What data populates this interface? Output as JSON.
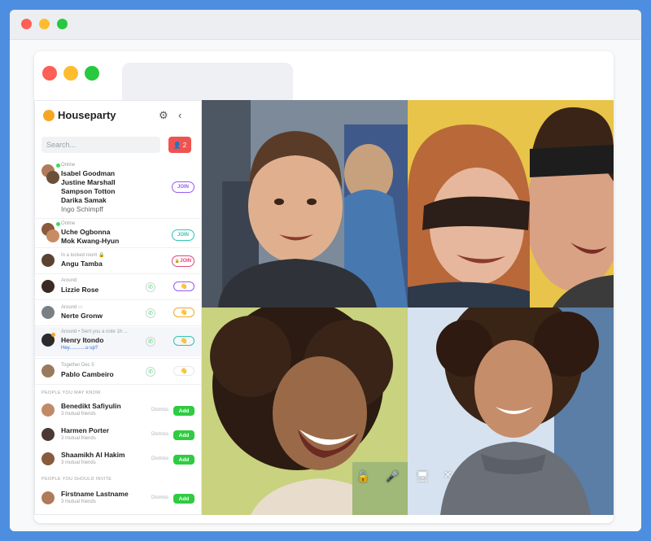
{
  "app": {
    "name": "Houseparty",
    "search_placeholder": "Search...",
    "friend_requests_count": "2",
    "settings_icon": "gear-icon",
    "collapse_icon": "chevron-left-icon"
  },
  "contacts": [
    {
      "status": "Online",
      "names": [
        "Isabel Goodman",
        "Justine Marshall",
        "Sampson Totton",
        "Darika Samak",
        "Ingo Schimpff"
      ],
      "action": "JOIN"
    },
    {
      "status": "Online",
      "names": [
        "Uche Ogbonna",
        "Mok Kwang-Hyun"
      ],
      "action": "JOIN"
    },
    {
      "status": "In a locked room",
      "names": [
        "Angu Tamba"
      ],
      "action": "JOIN"
    },
    {
      "status": "Around",
      "names": [
        "Lizzie Rose"
      ]
    },
    {
      "status": "Around",
      "names": [
        "Nerte Gronw"
      ]
    },
    {
      "status": "Around • Sent you a note 1h ...",
      "names": [
        "Henry Itondo"
      ],
      "note": "Hey............u up?"
    },
    {
      "status": "Together Dec 5",
      "names": [
        "Pablo Cambeiro"
      ]
    }
  ],
  "sections": {
    "people_you_may_know": "PEOPLE YOU MAY KNOW",
    "people_you_should_invite": "PEOPLE YOU SHOULD INVITE"
  },
  "suggestions": [
    {
      "name": "Benedikt Safiyulin",
      "mutual": "3 mutual friends",
      "dismiss": "Dismiss",
      "add": "Add"
    },
    {
      "name": "Harmen Porter",
      "mutual": "3 mutual friends",
      "dismiss": "Dismiss",
      "add": "Add"
    },
    {
      "name": "Shaamikh Al Hakim",
      "mutual": "3 mutual friends",
      "dismiss": "Dismiss",
      "add": "Add"
    }
  ],
  "invites": [
    {
      "name": "Firstname Lastname",
      "mutual": "3 mutual friends",
      "dismiss": "Dismiss",
      "add": "Add"
    }
  ],
  "colors": {
    "online_green": "#3ddc5a",
    "join_purple": "#9b59f6",
    "join_teal": "#2ec4b6",
    "join_pink": "#e0457b",
    "add_green": "#2ecc40",
    "request_red": "#ef5350"
  }
}
